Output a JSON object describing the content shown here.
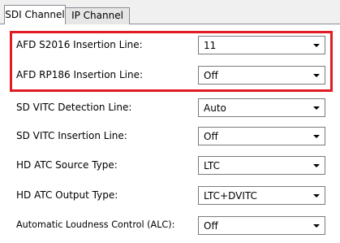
{
  "tabs": [
    {
      "label": "SDI Channel"
    },
    {
      "label": "IP Channel"
    }
  ],
  "fields": [
    {
      "label": "AFD S2016 Insertion Line:",
      "value": "11"
    },
    {
      "label": "AFD RP186 Insertion Line:",
      "value": "Off"
    },
    {
      "label": "SD VITC Detection Line:",
      "value": "Auto"
    },
    {
      "label": "SD VITC Insertion Line:",
      "value": "Off"
    },
    {
      "label": "HD ATC Source Type:",
      "value": "LTC"
    },
    {
      "label": "HD ATC Output Type:",
      "value": "LTC+DVITC"
    },
    {
      "label": "Automatic Loudness Control (ALC):",
      "value": "Off"
    }
  ],
  "icons": {
    "dropdown": "chevron-down-icon"
  },
  "colors": {
    "highlight": "#e01b24",
    "panel_bg": "#ffffff",
    "window_bg": "#f0f0f0"
  }
}
